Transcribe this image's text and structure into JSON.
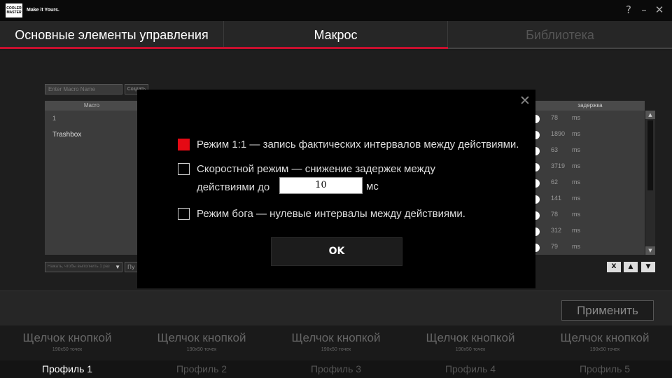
{
  "titlebar": {
    "logo_line1": "COOLER",
    "logo_line2": "MASTER",
    "slogan": "Make it Yours.",
    "help_icon": "?",
    "minimize_icon": "–",
    "close_icon": "✕"
  },
  "tabs": [
    {
      "label": "Основные элементы управления",
      "active": true
    },
    {
      "label": "Макрос",
      "active": true
    },
    {
      "label": "Библиотека",
      "active": false
    }
  ],
  "macro": {
    "name_placeholder": "Enter Macro Name",
    "create_label": "Создать",
    "list_header": "Macro",
    "items": [
      "1",
      "Trashbox"
    ],
    "select_value": "Нажать, чтобы выполнить 1 раз",
    "small_button_label": "Пу"
  },
  "delays": {
    "header": "задержка",
    "unit": "ms",
    "values": [
      "78",
      "1890",
      "63",
      "3719",
      "62",
      "141",
      "78",
      "312",
      "79"
    ]
  },
  "controls": {
    "delete": "X",
    "up": "▲",
    "down": "▼",
    "scroll_up": "▲",
    "scroll_down": "▼"
  },
  "apply_label": "Применить",
  "profiles": [
    {
      "button": "Щелчок кнопкой",
      "sub": "190x50 точек",
      "label": "Профиль 1",
      "active": true
    },
    {
      "button": "Щелчок кнопкой",
      "sub": "190x50 точек",
      "label": "Профиль 2",
      "active": false
    },
    {
      "button": "Щелчок кнопкой",
      "sub": "190x50 точек",
      "label": "Профиль 3",
      "active": false
    },
    {
      "button": "Щелчок кнопкой",
      "sub": "190x50 точек",
      "label": "Профиль 4",
      "active": false
    },
    {
      "button": "Щелчок кнопкой",
      "sub": "190x50 точек",
      "label": "Профиль 5",
      "active": false
    }
  ],
  "modal": {
    "close_icon": "✕",
    "option1": "Режим 1:1 — запись фактических интервалов между действиями.",
    "option1_checked": true,
    "option2_line1": "Скоростной режим — снижение задержек между",
    "option2_line2": "действиями до",
    "option2_checked": false,
    "speed_value": "10",
    "speed_unit": "мс",
    "option3": "Режим бога — нулевые интервалы между действиями.",
    "option3_checked": false,
    "ok_label": "OK"
  },
  "colors": {
    "accent": "#c8102e",
    "checked": "#e50914"
  }
}
